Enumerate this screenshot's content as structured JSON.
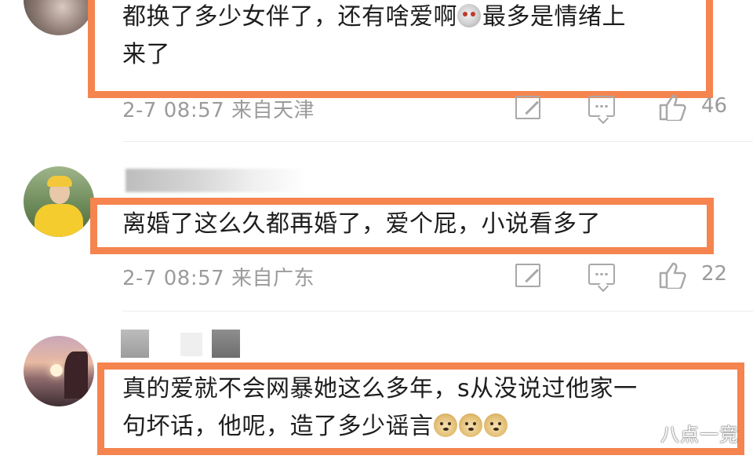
{
  "comments": [
    {
      "lines": [
        "都换了多少女伴了，还有啥爱啊",
        "最多是情绪上",
        "来了"
      ],
      "time": "2-7 08:57",
      "location": "来自天津",
      "likes": "46"
    },
    {
      "lines": [
        "离婚了这么久都再婚了，爱个屁，小说看多了"
      ],
      "time": "2-7 08:57",
      "location": "来自广东",
      "likes": "22"
    },
    {
      "lines": [
        "真的爱就不会网暴她这么多年，s从没说过他家一",
        "句坏话，他呢，造了多少谣言"
      ]
    }
  ],
  "icons": [
    "edit-icon",
    "comment-icon",
    "like-icon",
    "doge-emoji",
    "skull-emoji"
  ],
  "colors": {
    "highlight": "#f5844f",
    "meta_text": "#9b9b9b",
    "body_text": "#1e1e1e"
  },
  "watermark": "八点一竞"
}
